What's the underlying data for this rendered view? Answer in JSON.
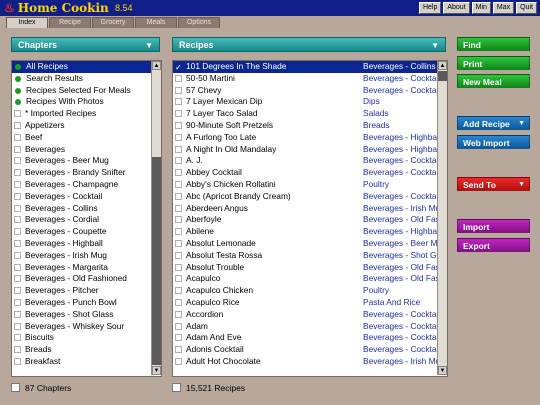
{
  "app": {
    "title": "Home Cookin",
    "version": "8.54"
  },
  "window_buttons": [
    "Help",
    "About",
    "Min",
    "Max",
    "Quit"
  ],
  "tabs": [
    "Index",
    "Recipe",
    "Grocery",
    "Meals",
    "Options"
  ],
  "chapters": {
    "header": "Chapters",
    "footer": "87 Chapters",
    "items": [
      {
        "label": "All Recipes",
        "dot": true,
        "selected": true
      },
      {
        "label": "Search Results",
        "dot": true
      },
      {
        "label": "Recipes Selected For Meals",
        "dot": true
      },
      {
        "label": "Recipes With Photos",
        "dot": true
      },
      {
        "label": "* Imported Recipes"
      },
      {
        "label": "Appetizers"
      },
      {
        "label": "Beef"
      },
      {
        "label": "Beverages"
      },
      {
        "label": "Beverages - Beer Mug"
      },
      {
        "label": "Beverages - Brandy Snifter"
      },
      {
        "label": "Beverages - Champagne"
      },
      {
        "label": "Beverages - Cocktail"
      },
      {
        "label": "Beverages - Collins"
      },
      {
        "label": "Beverages - Cordial"
      },
      {
        "label": "Beverages - Coupette"
      },
      {
        "label": "Beverages - Highball"
      },
      {
        "label": "Beverages - Irish Mug"
      },
      {
        "label": "Beverages - Margarita"
      },
      {
        "label": "Beverages - Old Fashioned"
      },
      {
        "label": "Beverages - Pitcher"
      },
      {
        "label": "Beverages - Punch Bowl"
      },
      {
        "label": "Beverages - Shot Glass"
      },
      {
        "label": "Beverages - Whiskey Sour"
      },
      {
        "label": "Biscuits"
      },
      {
        "label": "Breads"
      },
      {
        "label": "Breakfast"
      }
    ]
  },
  "recipes": {
    "header": "Recipes",
    "footer": "15,521 Recipes",
    "items": [
      {
        "name": "101 Degrees In The Shade",
        "category": "Beverages - Collins",
        "selected": true
      },
      {
        "name": "50-50 Martini",
        "category": "Beverages - Cocktail"
      },
      {
        "name": "57 Chevy",
        "category": "Beverages - Cocktail"
      },
      {
        "name": "7 Layer Mexican Dip",
        "category": "Dips"
      },
      {
        "name": "7 Layer Taco Salad",
        "category": "Salads"
      },
      {
        "name": "90-Minute Soft Pretzels",
        "category": "Breads"
      },
      {
        "name": "A Furlong Too Late",
        "category": "Beverages - Highball"
      },
      {
        "name": "A Night In Old Mandalay",
        "category": "Beverages - Highball"
      },
      {
        "name": "A. J.",
        "category": "Beverages - Cocktail"
      },
      {
        "name": "Abbey Cocktail",
        "category": "Beverages - Cocktail"
      },
      {
        "name": "Abby's Chicken Rollatini",
        "category": "Poultry"
      },
      {
        "name": "Abc (Apricot Brandy Cream)",
        "category": "Beverages - Cocktail"
      },
      {
        "name": "Aberdeen Angus",
        "category": "Beverages - Irish Mug"
      },
      {
        "name": "Aberfoyle",
        "category": "Beverages - Old Fashioned"
      },
      {
        "name": "Abilene",
        "category": "Beverages - Highball"
      },
      {
        "name": "Absolut Lemonade",
        "category": "Beverages - Beer Mug"
      },
      {
        "name": "Absolut Testa Rossa",
        "category": "Beverages - Shot Glass"
      },
      {
        "name": "Absolut Trouble",
        "category": "Beverages - Old Fashioned"
      },
      {
        "name": "Acapulco",
        "category": "Beverages - Old Fashioned"
      },
      {
        "name": "Acapulco Chicken",
        "category": "Poultry"
      },
      {
        "name": "Acapulco Rice",
        "category": "Pasta And Rice"
      },
      {
        "name": "Accordion",
        "category": "Beverages - Cocktail"
      },
      {
        "name": "Adam",
        "category": "Beverages - Cocktail"
      },
      {
        "name": "Adam And Eve",
        "category": "Beverages - Cocktail"
      },
      {
        "name": "Adonis Cocktail",
        "category": "Beverages - Cocktail"
      },
      {
        "name": "Adult Hot Chocolate",
        "category": "Beverages - Irish Mug"
      }
    ]
  },
  "actions": {
    "find": "Find",
    "print": "Print",
    "new_meal": "New Meal",
    "add_recipe": "Add Recipe",
    "web_import": "Web Import",
    "send_to": "Send To",
    "import": "Import",
    "export": "Export"
  },
  "colors": {
    "titlebar": "#0f1f87",
    "title_text": "#ffd800",
    "panel_header": "#128a8a",
    "selection": "#0a2690",
    "category_text": "#2030a8"
  }
}
